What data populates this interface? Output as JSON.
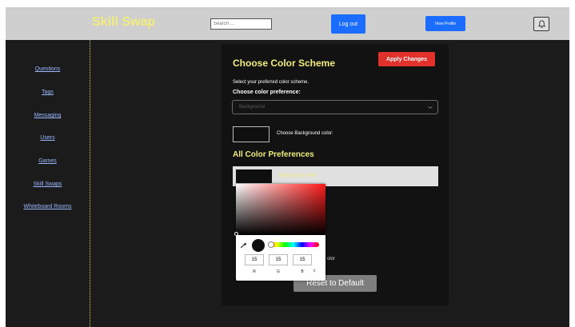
{
  "header": {
    "brand": "Skill Swap",
    "search_placeholder": "Search ...",
    "logout_label": "Log out",
    "view_profile_label": "View Profile",
    "bell_icon": "bell-icon"
  },
  "sidebar": {
    "items": [
      {
        "label": "Questions"
      },
      {
        "label": "Tags"
      },
      {
        "label": "Messaging"
      },
      {
        "label": "Users"
      },
      {
        "label": "Games"
      },
      {
        "label": "Skill Swaps"
      },
      {
        "label": "Whiteboard Rooms"
      }
    ]
  },
  "panel": {
    "title": "Choose Color Scheme",
    "apply_label": "Apply Changes",
    "subtitle": "Select your preferred color scheme.",
    "pref_label": "Choose color preference:",
    "select_value": "Background",
    "swatch_label": "Choose Background color:",
    "all_prefs_title": "All Color Preferences",
    "pref_row_label": "Background color",
    "behind_partial_1": "r",
    "behind_partial_2": "olor",
    "reset_label": "Reset to Default"
  },
  "picker": {
    "r": "15",
    "g": "15",
    "b": "15",
    "r_label": "R",
    "g_label": "G",
    "b_label": "B",
    "toggle": "⇕"
  },
  "colors": {
    "brand": "#f1ec7c",
    "accent_blue": "#1a6dff",
    "apply_red": "#e0312a",
    "selected_color": "#0f0f0f"
  }
}
